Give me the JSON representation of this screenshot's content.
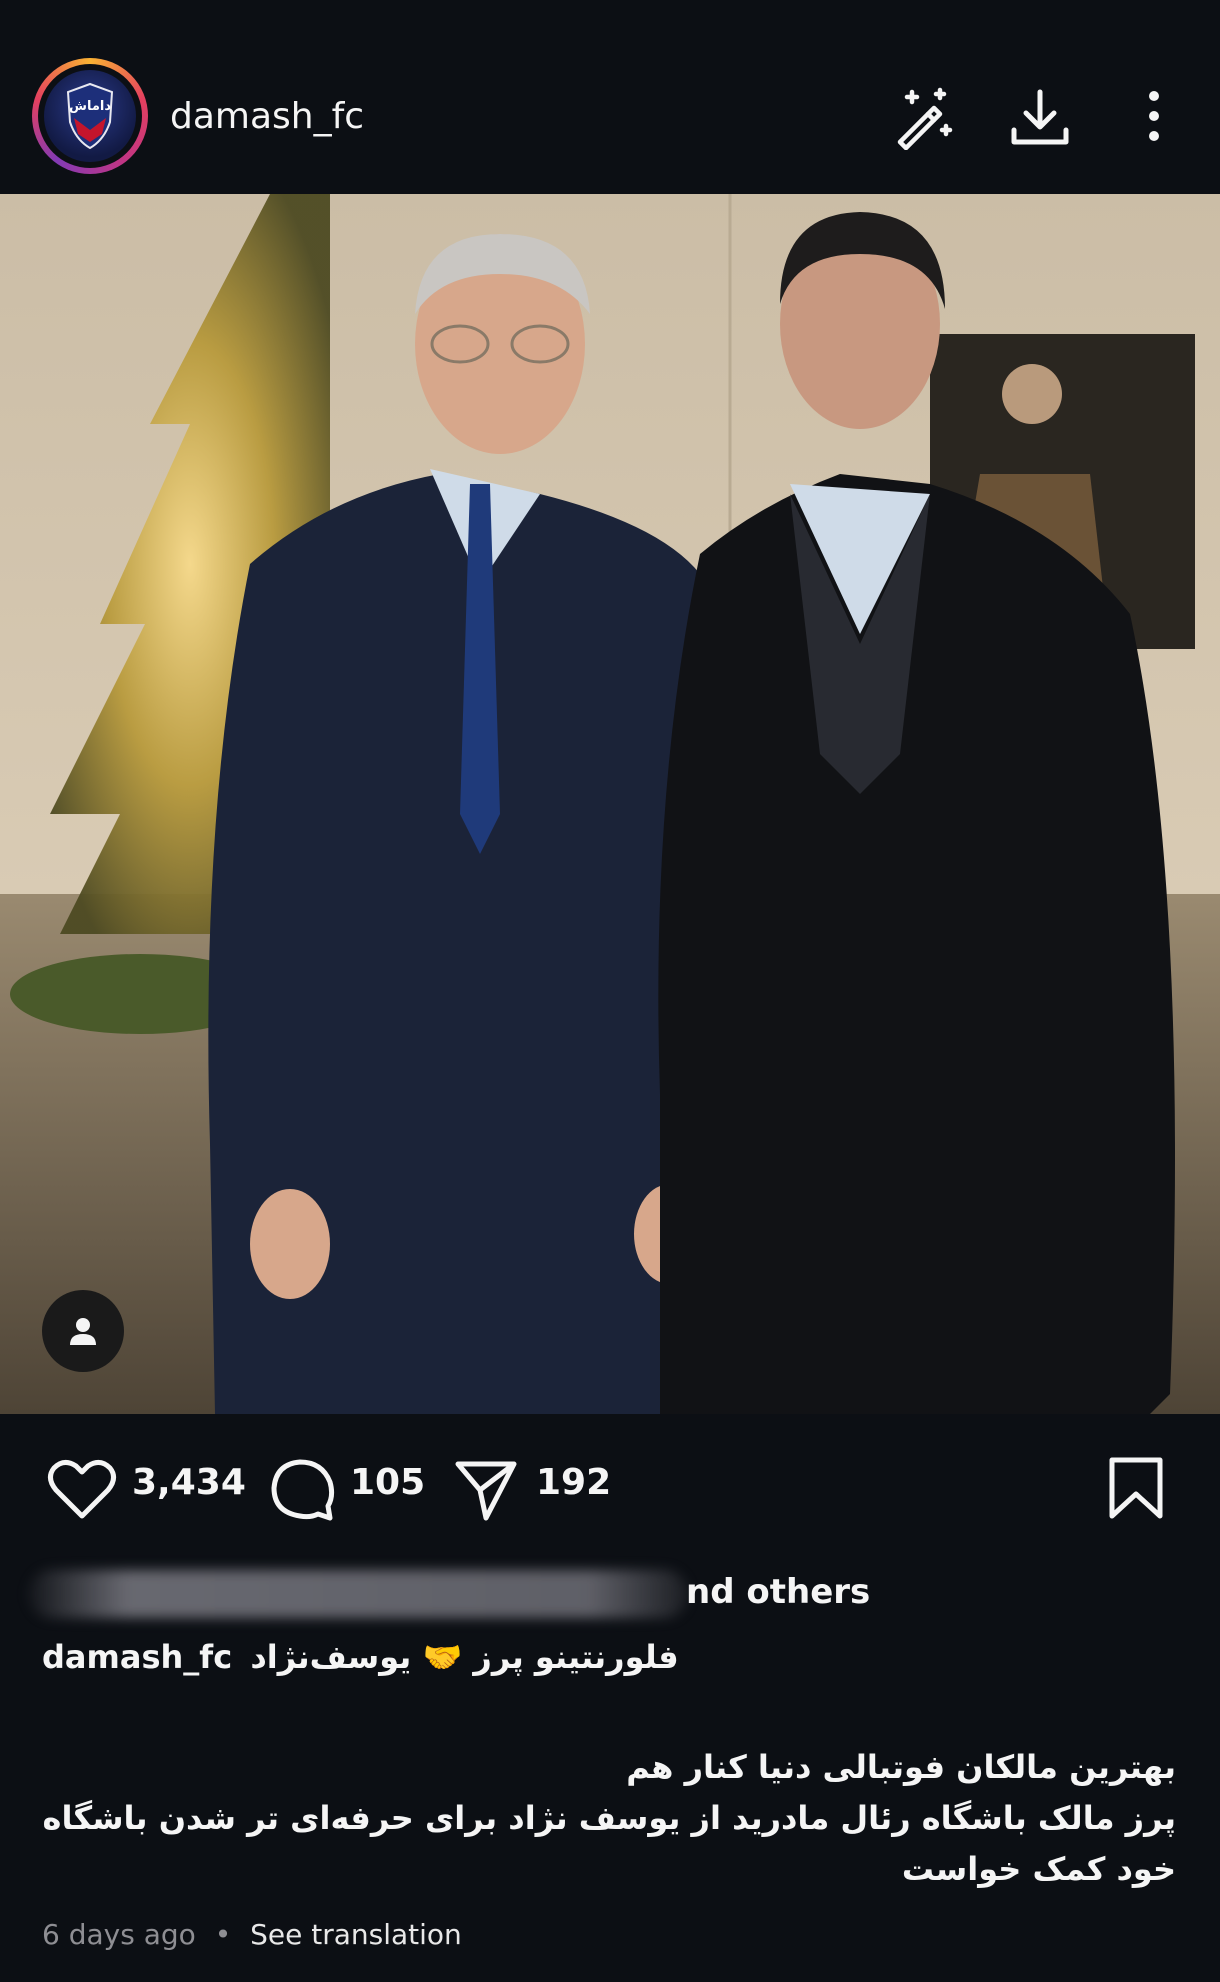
{
  "header": {
    "username": "damash_fc",
    "avatar_text": "داماش",
    "icons": [
      "magic-wand-icon",
      "download-icon",
      "more-vertical-icon"
    ]
  },
  "post": {
    "tag_icon": "person-icon"
  },
  "actions": {
    "likes": "3,434",
    "comments": "105",
    "shares": "192",
    "icons": [
      "heart-icon",
      "comment-icon",
      "send-icon",
      "bookmark-icon"
    ]
  },
  "liked_by": {
    "suffix": "nd others"
  },
  "caption": {
    "username": "damash_fc",
    "tags": "فلورنتینو پرز 🤝 یوسف‌نژاد",
    "line1": "بهترین مالکان فوتبالی دنیا کنار هم",
    "line2": "پرز مالک باشگاه رئال مادرید از یوسف نژاد برای حرفه‌ای تر شدن باشگاه خود کمک خواست"
  },
  "meta": {
    "time": "6 days ago",
    "separator": "•",
    "see_translation": "See translation"
  },
  "colors": {
    "background": "#0c0f14",
    "text": "#f5f5f5",
    "muted": "#8e8e93"
  }
}
